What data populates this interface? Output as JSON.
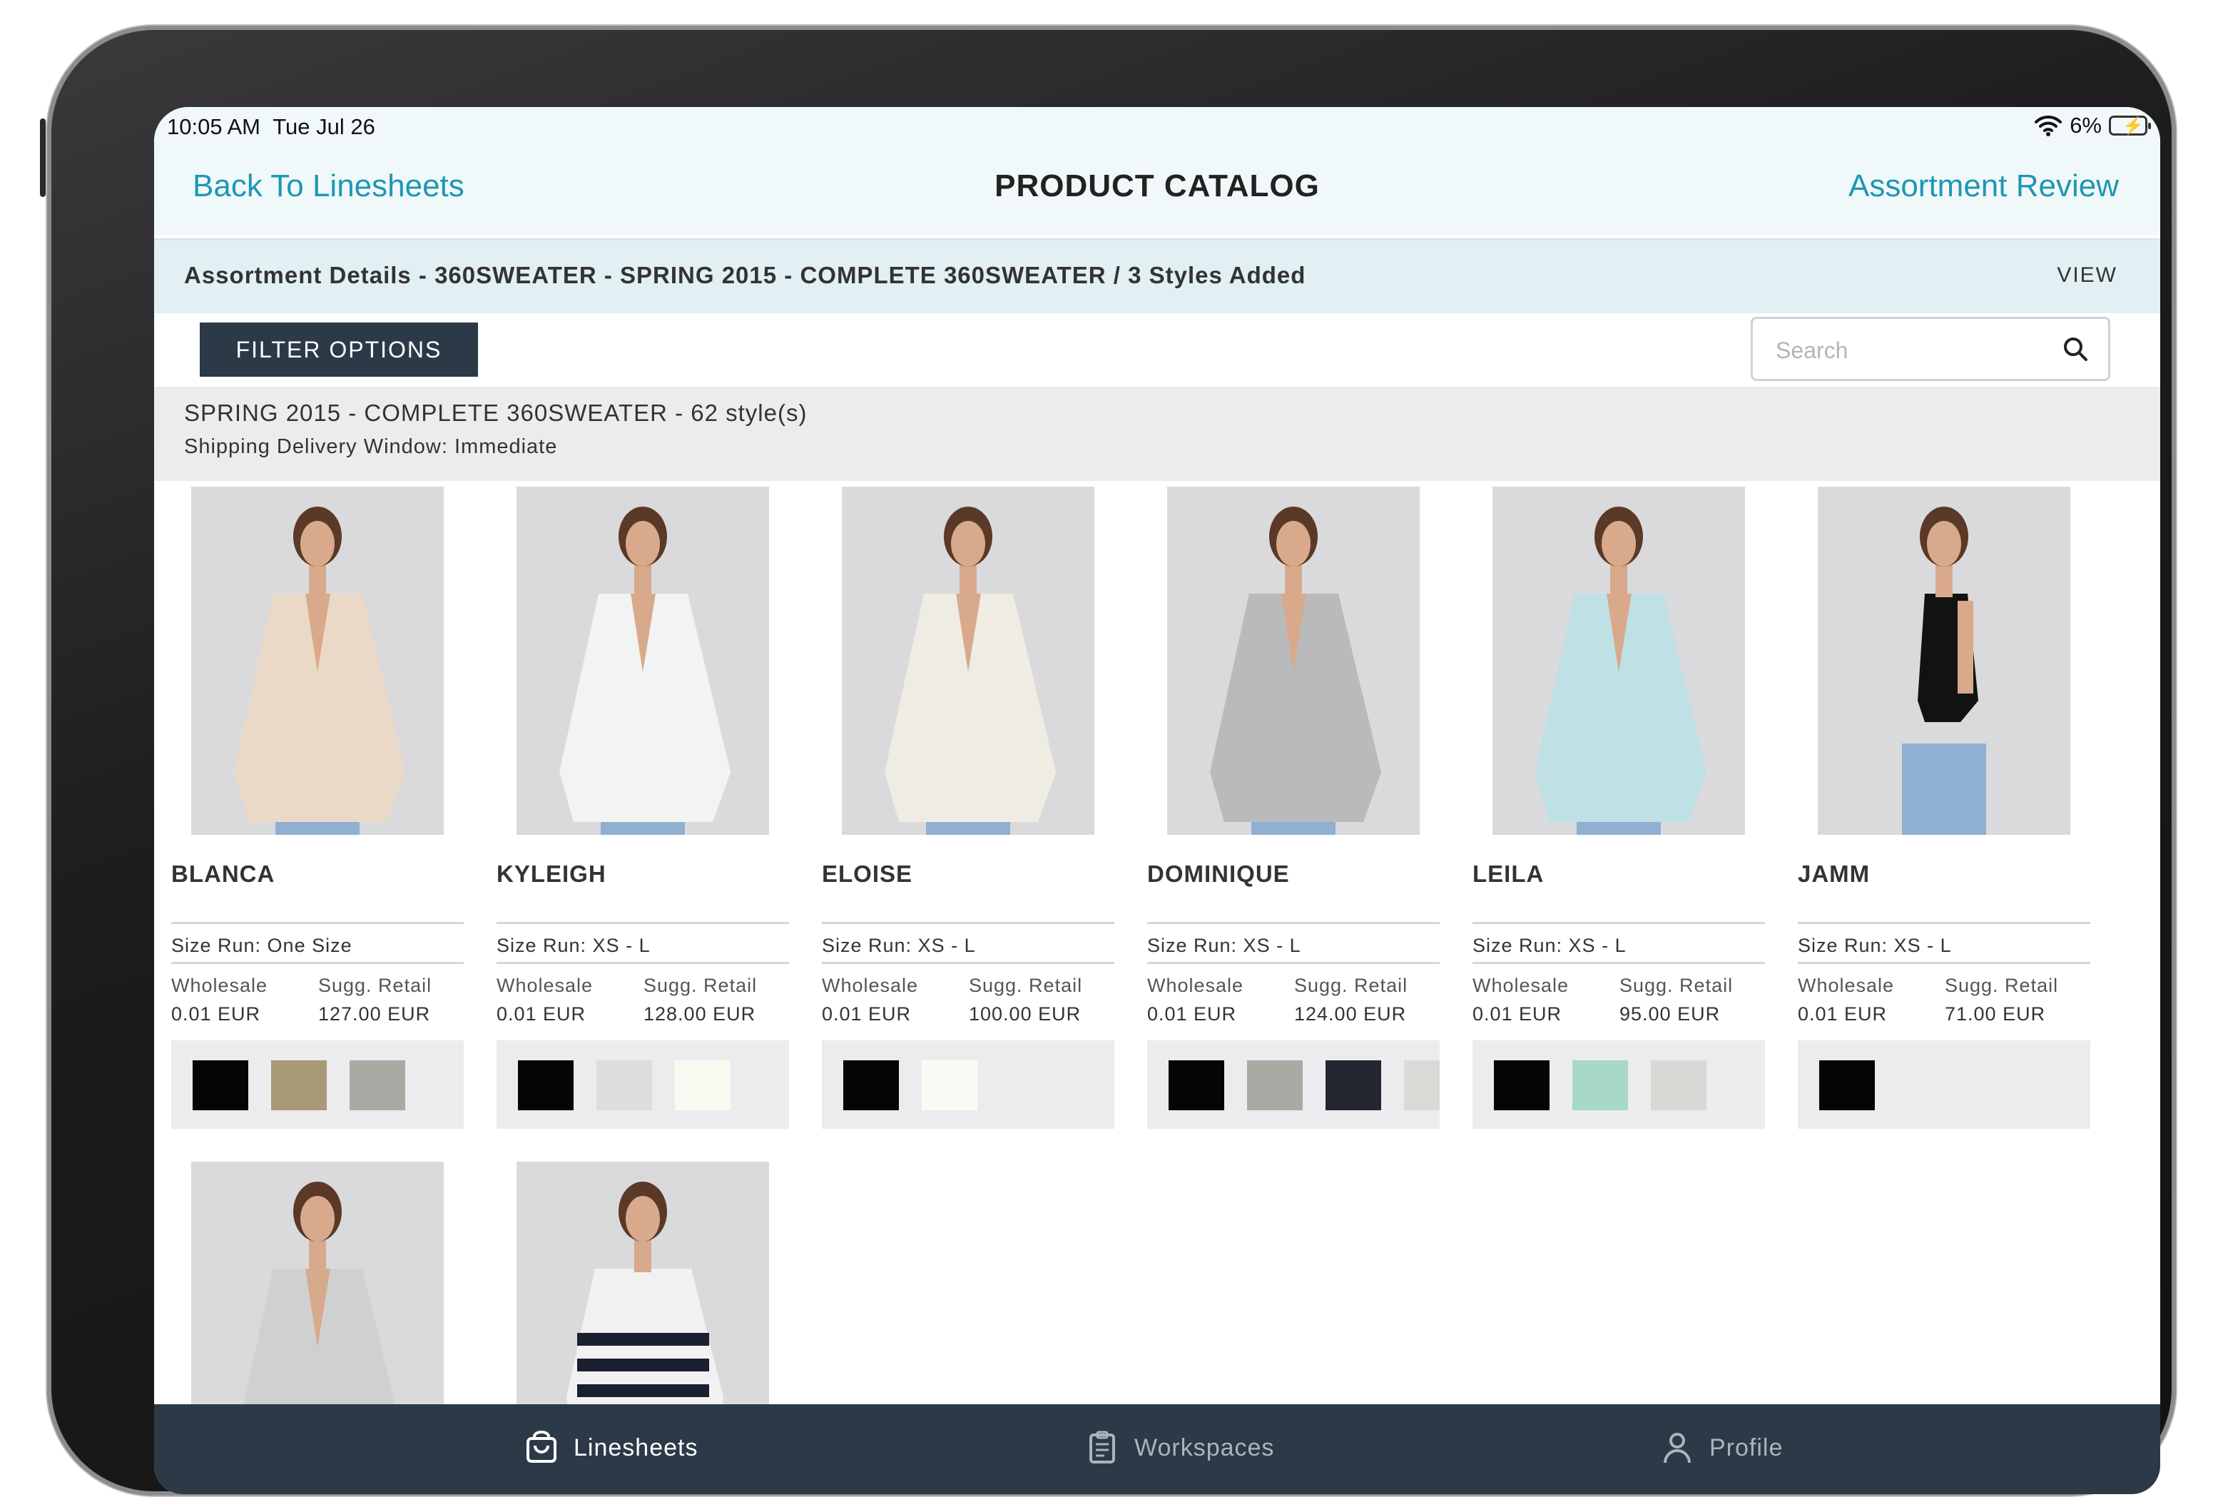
{
  "status_bar": {
    "time": "10:05 AM",
    "date": "Tue Jul 26",
    "battery": "6%"
  },
  "header": {
    "back_label": "Back To Linesheets",
    "title": "PRODUCT CATALOG",
    "review_label": "Assortment Review"
  },
  "assortment": {
    "details": "Assortment Details - 360SWEATER - SPRING 2015 - COMPLETE 360SWEATER / 3 Styles Added",
    "view_label": "VIEW"
  },
  "toolbar": {
    "filter_label": "FILTER OPTIONS",
    "search_placeholder": "Search"
  },
  "group": {
    "title": "SPRING 2015 - COMPLETE 360SWEATER - 62 style(s)",
    "delivery": "Shipping Delivery Window: Immediate"
  },
  "labels": {
    "wholesale": "Wholesale",
    "retail": "Sugg. Retail"
  },
  "products": [
    {
      "name": "BLANCA",
      "size_run": "Size Run: One Size",
      "wholesale": "0.01 EUR",
      "retail": "127.00 EUR",
      "garment": "#e9d9c6",
      "pose": "front",
      "swatches": [
        "#050505",
        "#a89a77",
        "#a8aaa4"
      ]
    },
    {
      "name": "KYLEIGH",
      "size_run": "Size Run: XS - L",
      "wholesale": "0.01 EUR",
      "retail": "128.00 EUR",
      "garment": "#f2f3f3",
      "pose": "front",
      "swatches": [
        "#050505",
        "#dcdedb",
        "#fbfaf2"
      ]
    },
    {
      "name": "ELOISE",
      "size_run": "Size Run: XS - L",
      "wholesale": "0.01 EUR",
      "retail": "100.00 EUR",
      "garment": "#efece4",
      "pose": "front",
      "swatches": [
        "#050505",
        "#fbfbf5"
      ]
    },
    {
      "name": "DOMINIQUE",
      "size_run": "Size Run: XS - L",
      "wholesale": "0.01 EUR",
      "retail": "124.00 EUR",
      "garment": "#b8babc",
      "pose": "front",
      "swatches": [
        "#050505",
        "#a9aaa3",
        "#23272f",
        "#d9dad6"
      ]
    },
    {
      "name": "LEILA",
      "size_run": "Size Run: XS - L",
      "wholesale": "0.01 EUR",
      "retail": "95.00 EUR",
      "garment": "#bfe0e4",
      "pose": "front",
      "swatches": [
        "#050505",
        "#a8d8c8",
        "#d8d9d5"
      ]
    },
    {
      "name": "JAMM",
      "size_run": "Size Run: XS - L",
      "wholesale": "0.01 EUR",
      "retail": "71.00 EUR",
      "garment": "#111213",
      "pose": "side",
      "swatches": [
        "#050505"
      ]
    },
    {
      "name": "",
      "garment": "#cfd0d2",
      "pose": "front",
      "partial": true
    },
    {
      "name": "",
      "garment": "#f1f1f1",
      "pose": "stripe",
      "partial": true
    }
  ],
  "tabbar": {
    "tabs": [
      {
        "label": "Linesheets",
        "icon": "bag-icon",
        "active": true
      },
      {
        "label": "Workspaces",
        "icon": "clipboard-icon",
        "active": false
      },
      {
        "label": "Profile",
        "icon": "person-icon",
        "active": false
      }
    ],
    "active_color": "#ffffff",
    "inactive_color": "#aab4bd"
  }
}
